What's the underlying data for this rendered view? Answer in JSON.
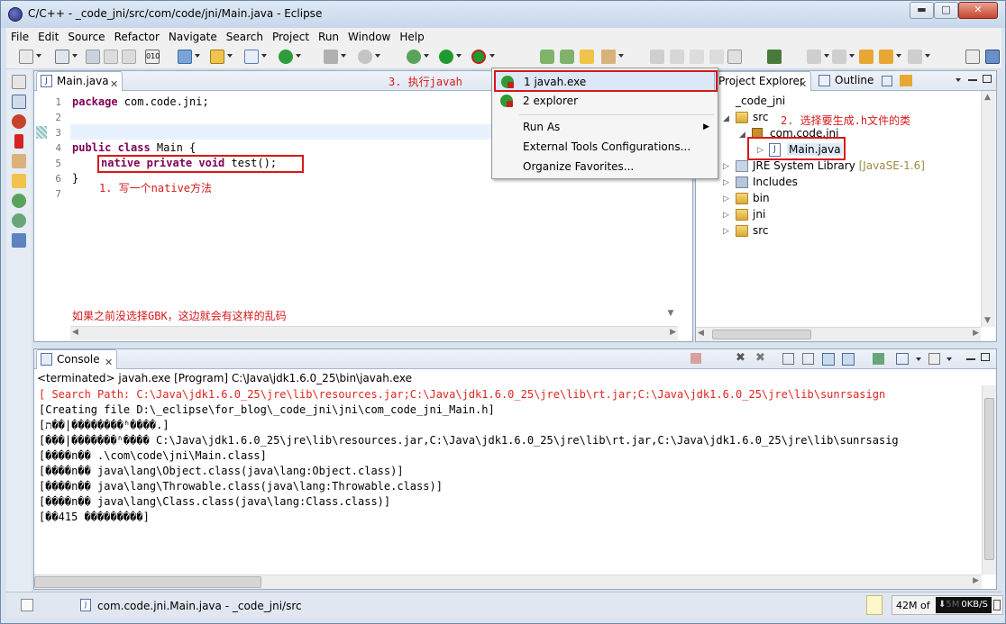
{
  "window": {
    "title": "C/C++ - _code_jni/src/com/code/jni/Main.java - Eclipse",
    "minimize": "▬",
    "maximize": "□",
    "close": "✕"
  },
  "menubar": [
    "File",
    "Edit",
    "Source",
    "Refactor",
    "Navigate",
    "Search",
    "Project",
    "Run",
    "Window",
    "Help"
  ],
  "editor": {
    "tab_label": "Main.java",
    "tab_icon": "J",
    "line_numbers": [
      "1",
      "2",
      "3",
      "4",
      "5",
      "6",
      "7"
    ],
    "lines": {
      "l1_kw": "package",
      "l1_rest": " com.code.jni;",
      "l4_kw": "public class",
      "l4_rest": " Main {",
      "l5_kw": "native private void",
      "l5_rest": " test();",
      "l6": "}"
    },
    "annotation_1": "1. 写一个native方法",
    "annotation_3": "3. 执行javah",
    "annotation_gbk": "如果之前没选择GBK，这边就会有这样的乱码"
  },
  "run_menu": {
    "items": [
      "1 javah.exe",
      "2 explorer",
      "Run As",
      "External Tools Configurations...",
      "Organize Favorites..."
    ],
    "submenu_arrow": "▶"
  },
  "project_explorer": {
    "tab_label": "Project Explorer",
    "outline_label": "Outline",
    "annotation_2": "2. 选择要生成.h文件的类",
    "tree": {
      "project": "_code_jni",
      "src": "src",
      "package": "com.code.jni",
      "file": "Main.java",
      "jre": "JRE System Library",
      "jre_version": "[JavaSE-1.6]",
      "includes": "Includes",
      "bin": "bin",
      "jni": "jni",
      "src2": "src"
    }
  },
  "console": {
    "tab_label": "Console",
    "header": "<terminated> javah.exe [Program] C:\\Java\\jdk1.6.0_25\\bin\\javah.exe",
    "lines": [
      "[ Search Path: C:\\Java\\jdk1.6.0_25\\jre\\lib\\resources.jar;C:\\Java\\jdk1.6.0_25\\jre\\lib\\rt.jar;C:\\Java\\jdk1.6.0_25\\jre\\lib\\sunrsasign",
      "[Creating file D:\\_eclipse\\for_blog\\_code_jni\\jni\\com_code_jni_Main.h]",
      "[ת��|��������ʱ����.]",
      "[���|�������ʱ���� C:\\Java\\jdk1.6.0_25\\jre\\lib\\resources.jar,C:\\Java\\jdk1.6.0_25\\jre\\lib\\rt.jar,C:\\Java\\jdk1.6.0_25\\jre\\lib\\sunrsasig",
      "[����n�� .\\com\\code\\jni\\Main.class]",
      "[����n�� java\\lang\\Object.class(java\\lang:Object.class)]",
      "[����n�� java\\lang\\Throwable.class(java\\lang:Throwable.class)]",
      "[����n�� java\\lang\\Class.class(java\\lang:Class.class)]",
      "[��415 ���������]"
    ]
  },
  "status": {
    "path": "com.code.jni.Main.java - _code_jni/src",
    "memory": "42M of",
    "net": "0KB/S",
    "mem_tail": "5M"
  }
}
